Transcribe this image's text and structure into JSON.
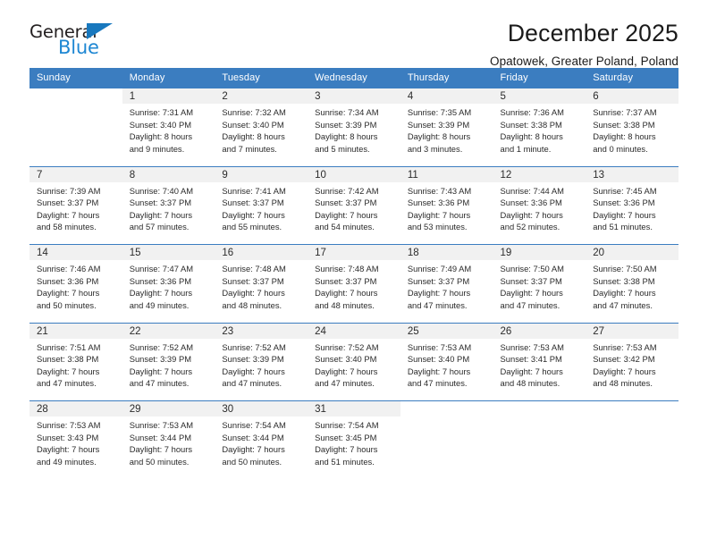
{
  "logo": {
    "word_top": "General",
    "word_bottom": "Blue",
    "triangle_color": "#1878be",
    "blue_color": "#1e87d3"
  },
  "header": {
    "title": "December 2025",
    "subtitle": "Opatowek, Greater Poland, Poland"
  },
  "theme": {
    "header_blue": "#3b7dc0",
    "daynum_gray": "#f1f1f1"
  },
  "calendar": {
    "weekday_headers": [
      "Sunday",
      "Monday",
      "Tuesday",
      "Wednesday",
      "Thursday",
      "Friday",
      "Saturday"
    ],
    "weeks": [
      [
        null,
        {
          "day": "1",
          "lines": [
            "Sunrise: 7:31 AM",
            "Sunset: 3:40 PM",
            "Daylight: 8 hours",
            "and 9 minutes."
          ]
        },
        {
          "day": "2",
          "lines": [
            "Sunrise: 7:32 AM",
            "Sunset: 3:40 PM",
            "Daylight: 8 hours",
            "and 7 minutes."
          ]
        },
        {
          "day": "3",
          "lines": [
            "Sunrise: 7:34 AM",
            "Sunset: 3:39 PM",
            "Daylight: 8 hours",
            "and 5 minutes."
          ]
        },
        {
          "day": "4",
          "lines": [
            "Sunrise: 7:35 AM",
            "Sunset: 3:39 PM",
            "Daylight: 8 hours",
            "and 3 minutes."
          ]
        },
        {
          "day": "5",
          "lines": [
            "Sunrise: 7:36 AM",
            "Sunset: 3:38 PM",
            "Daylight: 8 hours",
            "and 1 minute."
          ]
        },
        {
          "day": "6",
          "lines": [
            "Sunrise: 7:37 AM",
            "Sunset: 3:38 PM",
            "Daylight: 8 hours",
            "and 0 minutes."
          ]
        }
      ],
      [
        {
          "day": "7",
          "lines": [
            "Sunrise: 7:39 AM",
            "Sunset: 3:37 PM",
            "Daylight: 7 hours",
            "and 58 minutes."
          ]
        },
        {
          "day": "8",
          "lines": [
            "Sunrise: 7:40 AM",
            "Sunset: 3:37 PM",
            "Daylight: 7 hours",
            "and 57 minutes."
          ]
        },
        {
          "day": "9",
          "lines": [
            "Sunrise: 7:41 AM",
            "Sunset: 3:37 PM",
            "Daylight: 7 hours",
            "and 55 minutes."
          ]
        },
        {
          "day": "10",
          "lines": [
            "Sunrise: 7:42 AM",
            "Sunset: 3:37 PM",
            "Daylight: 7 hours",
            "and 54 minutes."
          ]
        },
        {
          "day": "11",
          "lines": [
            "Sunrise: 7:43 AM",
            "Sunset: 3:36 PM",
            "Daylight: 7 hours",
            "and 53 minutes."
          ]
        },
        {
          "day": "12",
          "lines": [
            "Sunrise: 7:44 AM",
            "Sunset: 3:36 PM",
            "Daylight: 7 hours",
            "and 52 minutes."
          ]
        },
        {
          "day": "13",
          "lines": [
            "Sunrise: 7:45 AM",
            "Sunset: 3:36 PM",
            "Daylight: 7 hours",
            "and 51 minutes."
          ]
        }
      ],
      [
        {
          "day": "14",
          "lines": [
            "Sunrise: 7:46 AM",
            "Sunset: 3:36 PM",
            "Daylight: 7 hours",
            "and 50 minutes."
          ]
        },
        {
          "day": "15",
          "lines": [
            "Sunrise: 7:47 AM",
            "Sunset: 3:36 PM",
            "Daylight: 7 hours",
            "and 49 minutes."
          ]
        },
        {
          "day": "16",
          "lines": [
            "Sunrise: 7:48 AM",
            "Sunset: 3:37 PM",
            "Daylight: 7 hours",
            "and 48 minutes."
          ]
        },
        {
          "day": "17",
          "lines": [
            "Sunrise: 7:48 AM",
            "Sunset: 3:37 PM",
            "Daylight: 7 hours",
            "and 48 minutes."
          ]
        },
        {
          "day": "18",
          "lines": [
            "Sunrise: 7:49 AM",
            "Sunset: 3:37 PM",
            "Daylight: 7 hours",
            "and 47 minutes."
          ]
        },
        {
          "day": "19",
          "lines": [
            "Sunrise: 7:50 AM",
            "Sunset: 3:37 PM",
            "Daylight: 7 hours",
            "and 47 minutes."
          ]
        },
        {
          "day": "20",
          "lines": [
            "Sunrise: 7:50 AM",
            "Sunset: 3:38 PM",
            "Daylight: 7 hours",
            "and 47 minutes."
          ]
        }
      ],
      [
        {
          "day": "21",
          "lines": [
            "Sunrise: 7:51 AM",
            "Sunset: 3:38 PM",
            "Daylight: 7 hours",
            "and 47 minutes."
          ]
        },
        {
          "day": "22",
          "lines": [
            "Sunrise: 7:52 AM",
            "Sunset: 3:39 PM",
            "Daylight: 7 hours",
            "and 47 minutes."
          ]
        },
        {
          "day": "23",
          "lines": [
            "Sunrise: 7:52 AM",
            "Sunset: 3:39 PM",
            "Daylight: 7 hours",
            "and 47 minutes."
          ]
        },
        {
          "day": "24",
          "lines": [
            "Sunrise: 7:52 AM",
            "Sunset: 3:40 PM",
            "Daylight: 7 hours",
            "and 47 minutes."
          ]
        },
        {
          "day": "25",
          "lines": [
            "Sunrise: 7:53 AM",
            "Sunset: 3:40 PM",
            "Daylight: 7 hours",
            "and 47 minutes."
          ]
        },
        {
          "day": "26",
          "lines": [
            "Sunrise: 7:53 AM",
            "Sunset: 3:41 PM",
            "Daylight: 7 hours",
            "and 48 minutes."
          ]
        },
        {
          "day": "27",
          "lines": [
            "Sunrise: 7:53 AM",
            "Sunset: 3:42 PM",
            "Daylight: 7 hours",
            "and 48 minutes."
          ]
        }
      ],
      [
        {
          "day": "28",
          "lines": [
            "Sunrise: 7:53 AM",
            "Sunset: 3:43 PM",
            "Daylight: 7 hours",
            "and 49 minutes."
          ]
        },
        {
          "day": "29",
          "lines": [
            "Sunrise: 7:53 AM",
            "Sunset: 3:44 PM",
            "Daylight: 7 hours",
            "and 50 minutes."
          ]
        },
        {
          "day": "30",
          "lines": [
            "Sunrise: 7:54 AM",
            "Sunset: 3:44 PM",
            "Daylight: 7 hours",
            "and 50 minutes."
          ]
        },
        {
          "day": "31",
          "lines": [
            "Sunrise: 7:54 AM",
            "Sunset: 3:45 PM",
            "Daylight: 7 hours",
            "and 51 minutes."
          ]
        },
        null,
        null,
        null
      ]
    ]
  }
}
